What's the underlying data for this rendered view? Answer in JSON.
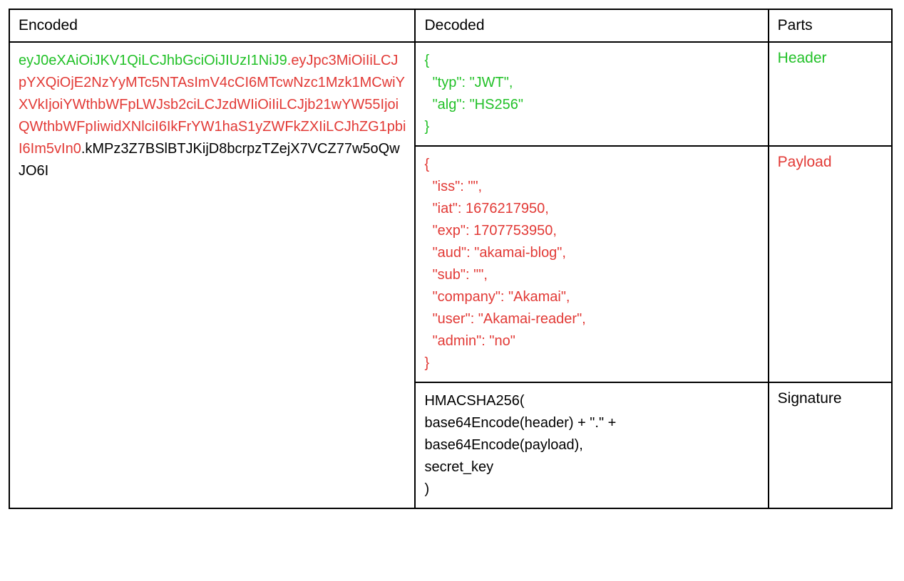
{
  "headers": {
    "encoded": "Encoded",
    "decoded": "Decoded",
    "parts": "Parts"
  },
  "encoded": {
    "header": "eyJ0eXAiOiJKV1QiLCJhbGciOiJIUzI1NiJ9",
    "payload": ".eyJpc3MiOiIiLCJpYXQiOjE2NzYyMTc5NTAsImV4cCI6MTcwNzc1Mzk1MCwiYXVkIjoiYWthbWFpLWJsb2ciLCJzdWIiOiIiLCJjb21wYW55IjoiQWthbWFpIiwidXNlciI6IkFrYW1haS1yZWFkZXIiLCJhZG1pbiI6Im5vIn0",
    "dot": ".",
    "signature": "kMPz3Z7BSlBTJKijD8bcrpzTZejX7VCZ77w5oQwJO6I"
  },
  "decoded": {
    "header_text": "{\n  \"typ\": \"JWT\",\n  \"alg\": \"HS256\"\n}",
    "payload_text": "{\n  \"iss\": \"\",\n  \"iat\": 1676217950,\n  \"exp\": 1707753950,\n  \"aud\": \"akamai-blog\",\n  \"sub\": \"\",\n  \"company\": \"Akamai\",\n  \"user\": \"Akamai-reader\",\n  \"admin\": \"no\"\n}",
    "signature_text": "HMACSHA256(\nbase64Encode(header) + \".\" +\nbase64Encode(payload),\nsecret_key\n)"
  },
  "parts": {
    "header": "Header",
    "payload": "Payload",
    "signature": "Signature"
  }
}
